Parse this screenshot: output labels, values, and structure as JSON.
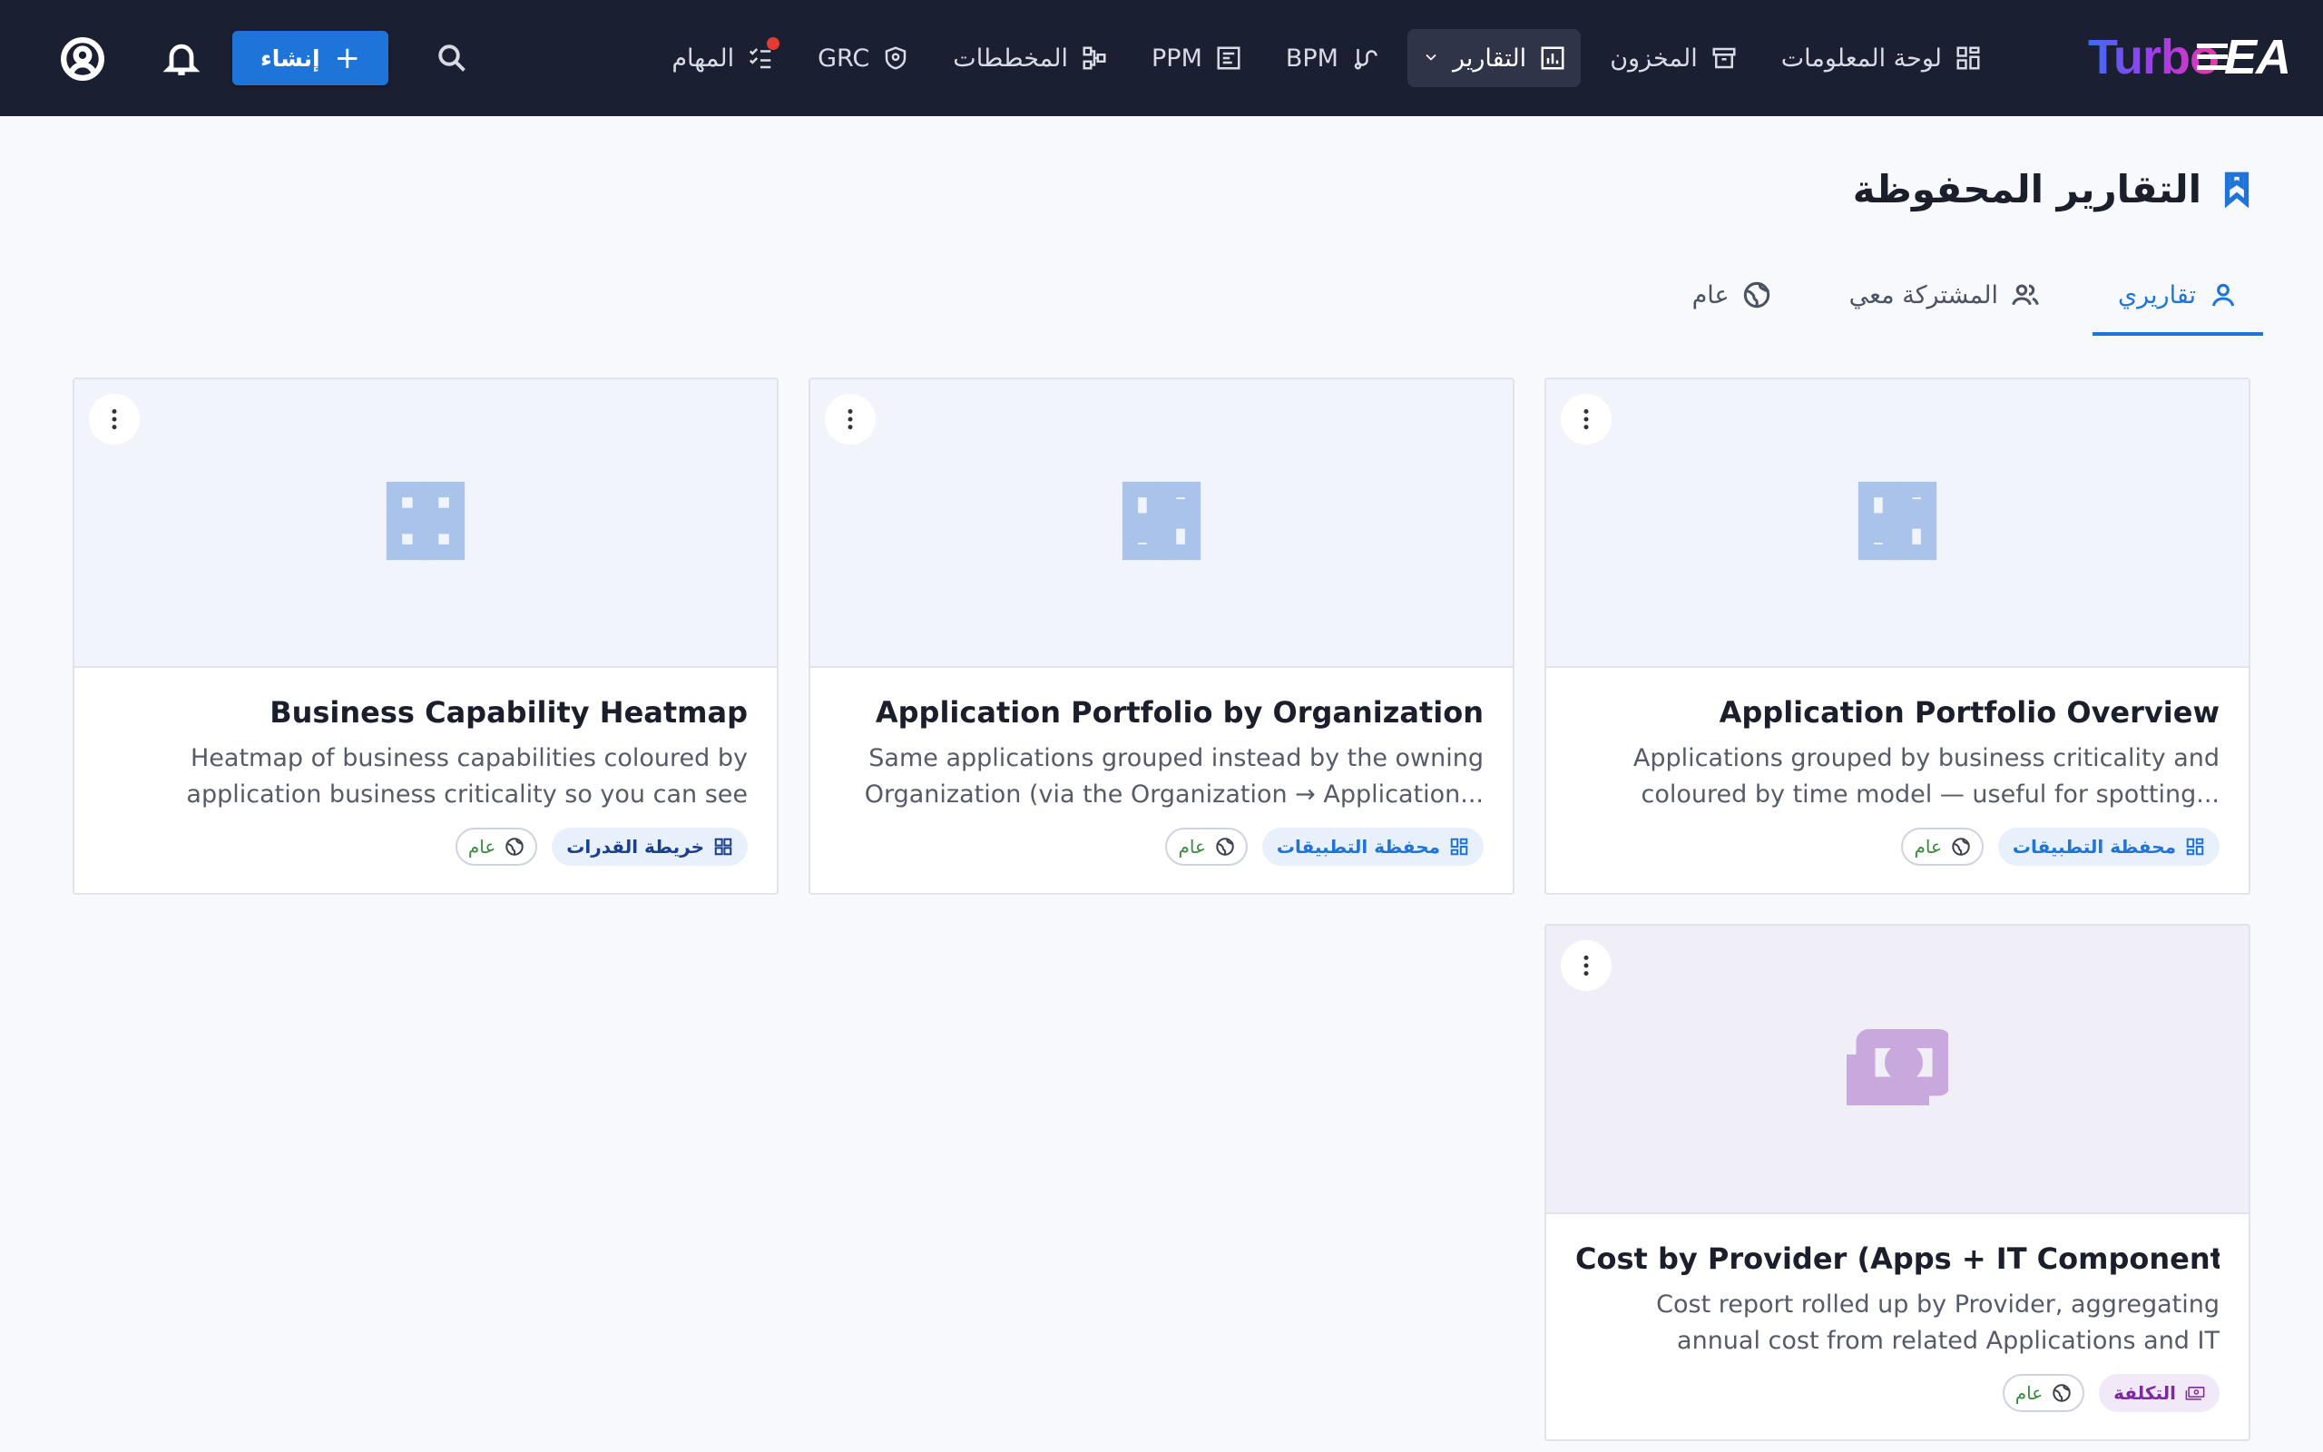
{
  "app": {
    "logo_primary": "Turbo",
    "logo_secondary": "EA"
  },
  "nav": {
    "items": [
      {
        "label": "لوحة المعلومات",
        "icon": "dashboard-icon"
      },
      {
        "label": "المخزون",
        "icon": "archive-icon"
      },
      {
        "label": "التقارير",
        "icon": "bar-chart-icon",
        "active": true
      },
      {
        "label": "BPM",
        "icon": "process-icon"
      },
      {
        "label": "PPM",
        "icon": "project-icon"
      },
      {
        "label": "المخططات",
        "icon": "diagram-icon"
      },
      {
        "label": "GRC",
        "icon": "shield-icon"
      },
      {
        "label": "المهام",
        "icon": "tasks-icon",
        "notification_dot": true
      }
    ],
    "create_label": "إنشاء"
  },
  "page": {
    "title": "التقارير المحفوظة"
  },
  "tabs": [
    {
      "label": "تقاريري",
      "icon": "person-icon",
      "active": true
    },
    {
      "label": "المشتركة معي",
      "icon": "people-icon"
    },
    {
      "label": "عام",
      "icon": "globe-icon"
    }
  ],
  "reports": [
    {
      "title": "Application Portfolio Overview",
      "description": "Applications grouped by business criticality and coloured by time model — useful for spotting...",
      "type_label": "محفظة التطبيقات",
      "visibility_label": "عام"
    },
    {
      "title": "Application Portfolio by Organization",
      "description": "Same applications grouped instead by the owning Organization (via the Organization → Application...",
      "type_label": "محفظة التطبيقات",
      "visibility_label": "عام"
    },
    {
      "title": "Business Capability Heatmap",
      "description": "Heatmap of business capabilities coloured by application business criticality so you can see where...",
      "type_label": "خريطة القدرات",
      "visibility_label": "عام"
    },
    {
      "title": "Cost by Provider (Apps + IT Components)",
      "description": "Cost report rolled up by Provider, aggregating annual cost from related Applications and IT Components — ...",
      "type_label": "التكلفة",
      "visibility_label": "عام"
    }
  ],
  "colors": {
    "topbar": "#1b1f32",
    "accent": "#1e74d8",
    "notification": "#e53935"
  }
}
